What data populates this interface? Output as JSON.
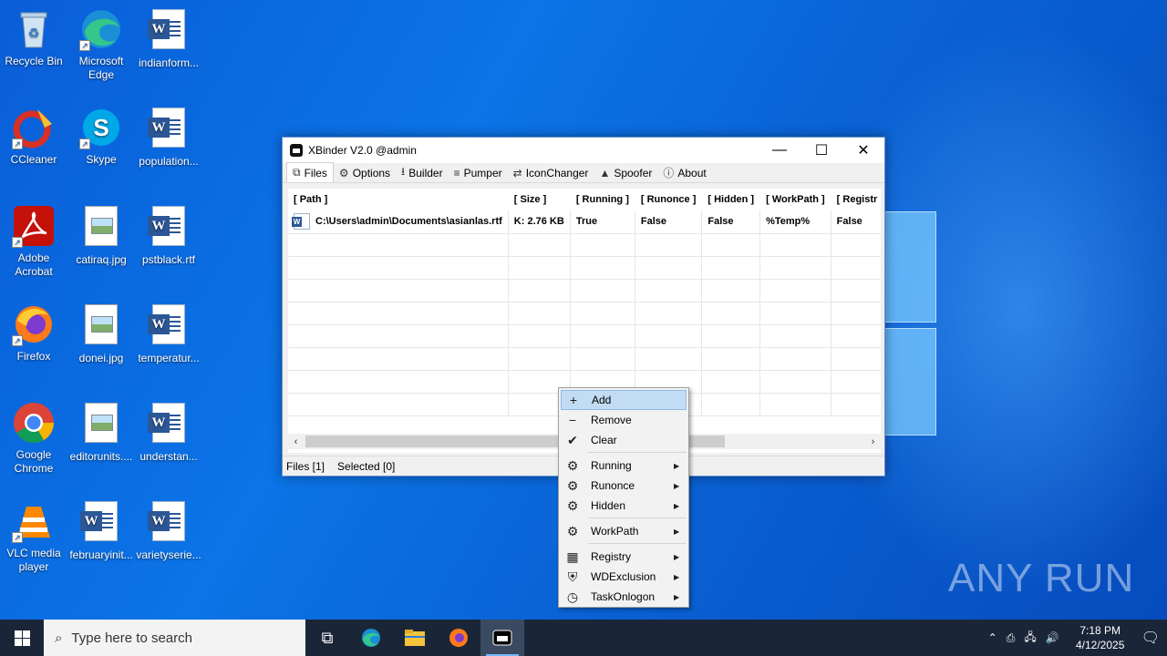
{
  "desktop": {
    "icons": [
      {
        "label": "Recycle Bin",
        "icon": "recycle-bin-icon"
      },
      {
        "label": "Microsoft Edge",
        "icon": "edge-icon"
      },
      {
        "label": "indianform...",
        "icon": "word-doc-icon"
      },
      {
        "label": "CCleaner",
        "icon": "ccleaner-icon"
      },
      {
        "label": "Skype",
        "icon": "skype-icon"
      },
      {
        "label": "population...",
        "icon": "word-doc-icon"
      },
      {
        "label": "Adobe Acrobat",
        "icon": "acrobat-icon"
      },
      {
        "label": "catiraq.jpg",
        "icon": "image-file-icon"
      },
      {
        "label": "pstblack.rtf",
        "icon": "word-doc-icon"
      },
      {
        "label": "Firefox",
        "icon": "firefox-icon"
      },
      {
        "label": "donei.jpg",
        "icon": "image-file-icon"
      },
      {
        "label": "temperatur...",
        "icon": "word-doc-icon"
      },
      {
        "label": "Google Chrome",
        "icon": "chrome-icon"
      },
      {
        "label": "editorunits....",
        "icon": "image-file-icon"
      },
      {
        "label": "understan...",
        "icon": "word-doc-icon"
      },
      {
        "label": "VLC media player",
        "icon": "vlc-icon"
      },
      {
        "label": "februaryinit...",
        "icon": "word-doc-icon"
      },
      {
        "label": "varietyserie...",
        "icon": "word-doc-icon"
      }
    ]
  },
  "window": {
    "title": "XBinder V2.0 @admin",
    "controls": {
      "minimize": "—",
      "maximize": "☐",
      "close": "✕"
    },
    "tabs": [
      {
        "label": "Files",
        "icon": "files-icon"
      },
      {
        "label": "Options",
        "icon": "gear-icon"
      },
      {
        "label": "Builder",
        "icon": "download-icon"
      },
      {
        "label": "Pumper",
        "icon": "pump-icon"
      },
      {
        "label": "IconChanger",
        "icon": "swap-icon"
      },
      {
        "label": "Spoofer",
        "icon": "spy-icon"
      },
      {
        "label": "About",
        "icon": "info-icon"
      }
    ],
    "columns": [
      "[ Path ]",
      "[ Size ]",
      "[ Running ]",
      "[ Runonce ]",
      "[ Hidden ]",
      "[ WorkPath ]",
      "[ Registr"
    ],
    "rows": [
      {
        "path": "C:\\Users\\admin\\Documents\\asianlas.rtf",
        "size": "K: 2.76 KB",
        "running": "True",
        "runonce": "False",
        "hidden": "False",
        "workpath": "%Temp%",
        "registry": "False"
      }
    ],
    "status": {
      "files": "Files [1]",
      "selected": "Selected [0]"
    }
  },
  "context_menu": {
    "items": [
      {
        "label": "Add",
        "icon": "plus-icon",
        "submenu": false
      },
      {
        "label": "Remove",
        "icon": "minus-icon",
        "submenu": false
      },
      {
        "label": "Clear",
        "icon": "broom-icon",
        "submenu": false
      },
      {
        "label": "Running",
        "icon": "gear-icon",
        "submenu": true
      },
      {
        "label": "Runonce",
        "icon": "gear-icon",
        "submenu": true
      },
      {
        "label": "Hidden",
        "icon": "gear-icon",
        "submenu": true
      },
      {
        "label": "WorkPath",
        "icon": "gear-icon",
        "submenu": true
      },
      {
        "label": "Registry",
        "icon": "registry-icon",
        "submenu": true
      },
      {
        "label": "WDExclusion",
        "icon": "shield-icon",
        "submenu": true
      },
      {
        "label": "TaskOnlogon",
        "icon": "clock-icon",
        "submenu": true
      }
    ]
  },
  "taskbar": {
    "search_placeholder": "Type here to search",
    "time": "7:18 PM",
    "date": "4/12/2025"
  },
  "watermark": "ANY RUN"
}
